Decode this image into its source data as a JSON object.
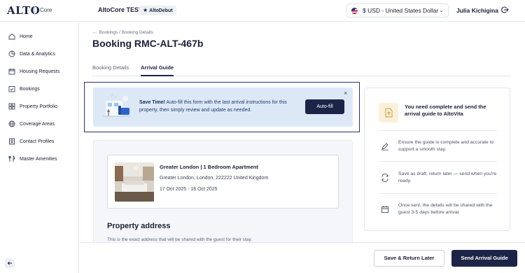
{
  "app": {
    "logo": "ALTO",
    "product": "Core",
    "company": "AltoCore TEST",
    "badge": "AltoDebut"
  },
  "header": {
    "currency": "$ USD - United States Dollar",
    "user": "Julia Kichigina"
  },
  "sidebar": {
    "items": [
      {
        "label": "Home",
        "icon": "home-icon"
      },
      {
        "label": "Data & Analytics",
        "icon": "chart-icon"
      },
      {
        "label": "Housing Requests",
        "icon": "calendar-icon"
      },
      {
        "label": "Bookings",
        "icon": "calendar-check-icon"
      },
      {
        "label": "Property Portfolio",
        "icon": "grid-icon"
      },
      {
        "label": "Coverage Areas",
        "icon": "globe-icon"
      },
      {
        "label": "Contact Profiles",
        "icon": "contact-icon"
      },
      {
        "label": "Master Amenities",
        "icon": "amenities-icon"
      }
    ]
  },
  "breadcrumb": {
    "parent": "Bookings",
    "separator": "/",
    "current": "Booking Details"
  },
  "page": {
    "title": "Booking RMC-ALT-467b"
  },
  "tabs": [
    {
      "label": "Booking Details"
    },
    {
      "label": "Arrival Guide"
    }
  ],
  "banner": {
    "bold": "Save Time!",
    "text": " Auto-fill this form with the last arrival instructions for this property, then simply review and update as needed.",
    "button": "Auto-fill"
  },
  "property": {
    "title": "Greater London | 1 Bedroom Apartment",
    "address": "Greater London, London, 222222 United Kingdom",
    "dates": "17 Oct 2025 - 18 Oct 2025"
  },
  "section": {
    "title": "Property address",
    "desc": "This is the exact address that will be shared with the guest for their stay."
  },
  "side_panel": {
    "heading": "You need complete and send the arrival guide to AltoVita",
    "items": [
      {
        "icon": "edit-icon",
        "text": "Ensure the guide is complete and accurate to support a smooth stay."
      },
      {
        "icon": "sync-icon",
        "text": "Save as draft, return later — send when you're ready."
      },
      {
        "icon": "calendar-icon",
        "text": "Once sent, the details will be shared with the guest 3-5 days before arrival."
      }
    ]
  },
  "footer": {
    "secondary": "Save & Return Later",
    "primary": "Send Arrival Guide"
  }
}
